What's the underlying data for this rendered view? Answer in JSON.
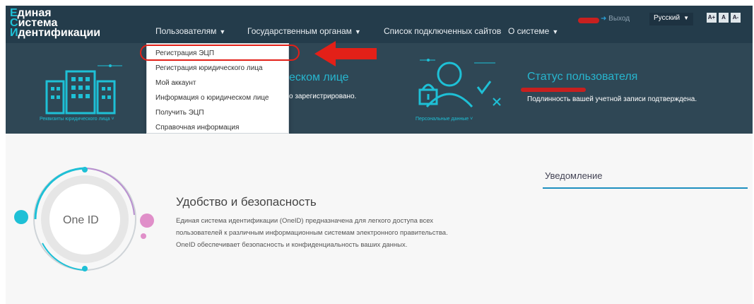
{
  "header": {
    "logo_line1": {
      "initial": "Е",
      "rest": "диная"
    },
    "logo_line2": {
      "initial": "С",
      "rest": "истема"
    },
    "logo_line3": {
      "initial": "И",
      "rest": "дентификации"
    },
    "nav": [
      {
        "label": "Пользователям",
        "caret": "▼"
      },
      {
        "label": "Государственным органам",
        "caret": "▼"
      },
      {
        "label": "Список подключенных сайтов"
      },
      {
        "label": "О системе",
        "caret": "▼"
      }
    ],
    "logout_label": "Выход",
    "language": "Русский",
    "font_buttons": [
      "A+",
      "A",
      "A-"
    ]
  },
  "banner": {
    "legal_caption": "Реквизиты юридического лица",
    "legal_title_tail": "еском лице",
    "legal_text_tail": "о зарегистрировано.",
    "personal_caption": "Персональные данные",
    "status_title": "Статус пользователя",
    "status_value": "Подлинность вашей учетной записи подтверждена."
  },
  "dropdown": {
    "items": [
      "Регистрация ЭЦП",
      "Регистрация юридического лица",
      "Мой аккаунт",
      "Информация о юридическом лице",
      "Получить ЭЦП",
      "Справочная информация"
    ]
  },
  "feature": {
    "circle_label": "One ID",
    "title": "Удобство и безопасность",
    "lines": [
      "Единая система идентификации (OneID) предназначена для легкого доступа всех",
      "пользователей к различным информационным системам электронного правительства.",
      "OneID обеспечивает безопасность и конфиденциальность ваших данных."
    ]
  },
  "notifications": {
    "title": "Уведомление"
  },
  "colors": {
    "header_bg": "#243c4b",
    "banner_bg": "#2f4755",
    "accent": "#1ec0d6",
    "highlight": "#e32018"
  }
}
